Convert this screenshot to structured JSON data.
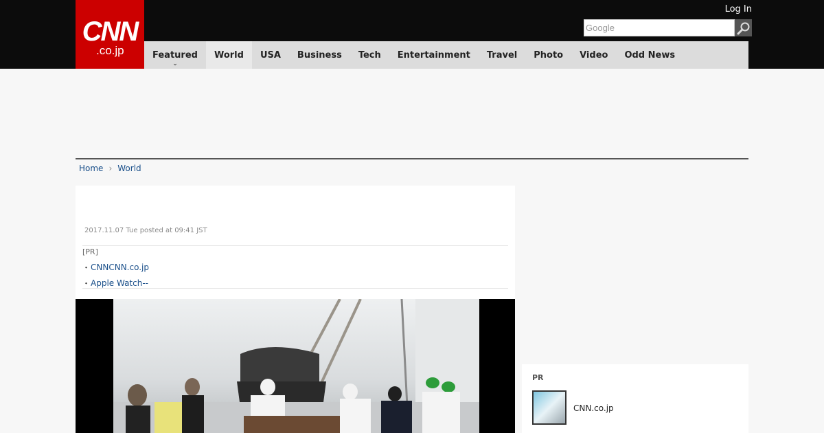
{
  "header": {
    "logo_main": "CNN",
    "logo_sub": ".co.jp",
    "login_label": "Log In",
    "search_placeholder": "Google"
  },
  "nav": {
    "items": [
      {
        "label": "Featured"
      },
      {
        "label": "World"
      },
      {
        "label": "USA"
      },
      {
        "label": "Business"
      },
      {
        "label": "Tech"
      },
      {
        "label": "Entertainment"
      },
      {
        "label": "Travel"
      },
      {
        "label": "Photo"
      },
      {
        "label": "Video"
      },
      {
        "label": "Odd News"
      }
    ]
  },
  "breadcrumb": {
    "home": "Home",
    "current": "World"
  },
  "article": {
    "posted": "2017.11.07 Tue posted at 09:41 JST",
    "pr_tag": "[PR]",
    "pr_links": [
      "CNNCNN.co.jp",
      "Apple Watch--"
    ]
  },
  "sidebar": {
    "pr_label": "PR",
    "pr_item_title": "CNN.co.jp"
  },
  "colors": {
    "brand_red": "#cc0000",
    "topbar": "#0c0c0c",
    "nav_bg": "#dcdcdc",
    "link": "#1a4f8a"
  }
}
